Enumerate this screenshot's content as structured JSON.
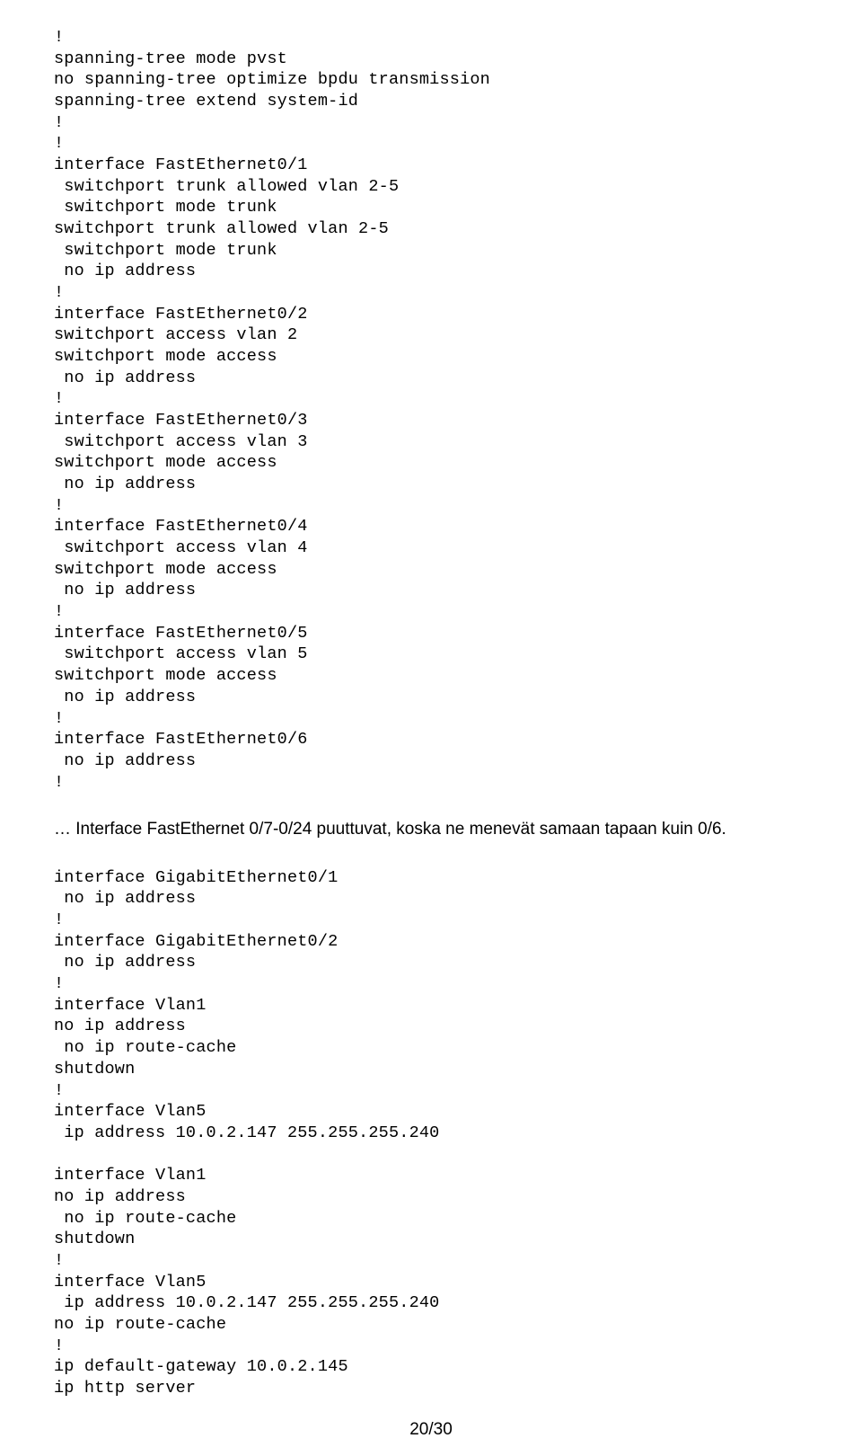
{
  "block1": "!\nspanning-tree mode pvst\nno spanning-tree optimize bpdu transmission\nspanning-tree extend system-id\n!\n!\ninterface FastEthernet0/1\n switchport trunk allowed vlan 2-5\n switchport mode trunk\nswitchport trunk allowed vlan 2-5\n switchport mode trunk\n no ip address\n!\ninterface FastEthernet0/2\nswitchport access vlan 2\nswitchport mode access\n no ip address\n!\ninterface FastEthernet0/3\n switchport access vlan 3\nswitchport mode access\n no ip address\n!\ninterface FastEthernet0/4\n switchport access vlan 4\nswitchport mode access\n no ip address\n!\ninterface FastEthernet0/5\n switchport access vlan 5\nswitchport mode access\n no ip address\n!\ninterface FastEthernet0/6\n no ip address\n!",
  "note": "… Interface FastEthernet 0/7-0/24 puuttuvat, koska ne menevät samaan tapaan kuin 0/6.",
  "block2": "interface GigabitEthernet0/1\n no ip address\n!\ninterface GigabitEthernet0/2\n no ip address\n!\ninterface Vlan1\nno ip address\n no ip route-cache\nshutdown\n!\ninterface Vlan5\n ip address 10.0.2.147 255.255.255.240\n\ninterface Vlan1\nno ip address\n no ip route-cache\nshutdown\n!\ninterface Vlan5\n ip address 10.0.2.147 255.255.255.240\nno ip route-cache\n!\nip default-gateway 10.0.2.145\nip http server",
  "pageNumber": "20/30"
}
